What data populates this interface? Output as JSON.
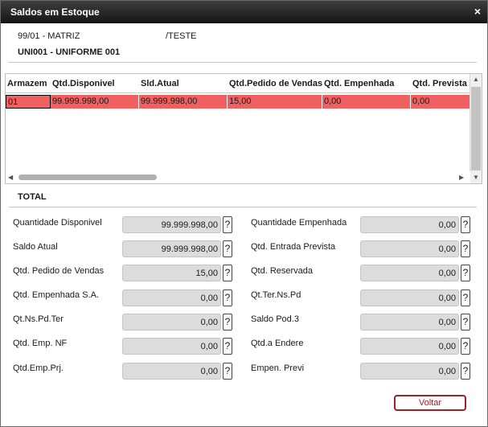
{
  "window": {
    "title": "Saldos em Estoque",
    "close_glyph": "×"
  },
  "header": {
    "empresa": "99/01 - MATRIZ",
    "filial": "/TESTE",
    "produto": "UNI001 - UNIFORME 001"
  },
  "grid": {
    "columns": [
      "Armazem",
      "Qtd.Disponivel",
      "Sld.Atual",
      "Qtd.Pedido de Vendas",
      "Qtd. Empenhada",
      "Qtd. Prevista"
    ],
    "rows": [
      [
        "01",
        "99.999.998,00",
        "99.999.998,00",
        "15,00",
        "0,00",
        "0,00"
      ]
    ],
    "scroll_up": "▲",
    "scroll_down": "▼",
    "scroll_left": "◀",
    "scroll_right": "▶"
  },
  "totals": {
    "section_label": "TOTAL",
    "help_glyph": "?",
    "left": [
      {
        "label": "Quantidade Disponivel",
        "value": "99.999.998,00"
      },
      {
        "label": "Saldo Atual",
        "value": "99.999.998,00"
      },
      {
        "label": "Qtd. Pedido de Vendas",
        "value": "15,00"
      },
      {
        "label": "Qtd. Empenhada S.A.",
        "value": "0,00"
      },
      {
        "label": "Qt.Ns.Pd.Ter",
        "value": "0,00"
      },
      {
        "label": "Qtd. Emp. NF",
        "value": "0,00"
      },
      {
        "label": "Qtd.Emp.Prj.",
        "value": "0,00"
      }
    ],
    "right": [
      {
        "label": "Quantidade Empenhada",
        "value": "0,00"
      },
      {
        "label": "Qtd. Entrada Prevista",
        "value": "0,00"
      },
      {
        "label": "Qtd. Reservada",
        "value": "0,00"
      },
      {
        "label": "Qt.Ter.Ns.Pd",
        "value": "0,00"
      },
      {
        "label": "Saldo Pod.3",
        "value": "0,00"
      },
      {
        "label": "Qtd.a Endere",
        "value": "0,00"
      },
      {
        "label": "Empen. Previ",
        "value": "0,00"
      }
    ]
  },
  "buttons": {
    "voltar": "Voltar"
  },
  "colors": {
    "selected_row": "#f06060",
    "titlebar": "#2a2a2a",
    "button_accent": "#a02028"
  }
}
